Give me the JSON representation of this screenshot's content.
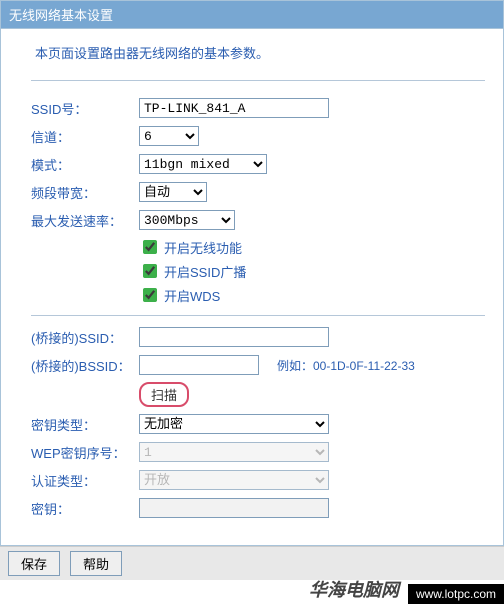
{
  "header": {
    "title": "无线网络基本设置"
  },
  "intro": "本页面设置路由器无线网络的基本参数。",
  "fields": {
    "ssid": {
      "label": "SSID号：",
      "value": "TP-LINK_841_A"
    },
    "channel": {
      "label": "信道：",
      "value": "6"
    },
    "mode": {
      "label": "模式：",
      "value": "11bgn mixed"
    },
    "bandwidth": {
      "label": "频段带宽：",
      "value": "自动"
    },
    "maxrate": {
      "label": "最大发送速率：",
      "value": "300Mbps"
    }
  },
  "checks": {
    "enable_wireless": "开启无线功能",
    "enable_ssid": "开启SSID广播",
    "enable_wds": "开启WDS"
  },
  "bridge": {
    "ssid": {
      "label": "(桥接的)SSID：",
      "value": ""
    },
    "bssid": {
      "label": "(桥接的)BSSID：",
      "value": "",
      "example": "例如：00-1D-0F-11-22-33"
    },
    "scan": "扫描",
    "key_type": {
      "label": "密钥类型：",
      "value": "无加密"
    },
    "wep_index": {
      "label": "WEP密钥序号：",
      "value": "1"
    },
    "auth_type": {
      "label": "认证类型：",
      "value": "开放"
    },
    "key": {
      "label": "密钥：",
      "value": ""
    }
  },
  "footer": {
    "save": "保存",
    "help": "帮助"
  },
  "watermark": {
    "name": "华海电脑网",
    "url": "www.lotpc.com"
  }
}
